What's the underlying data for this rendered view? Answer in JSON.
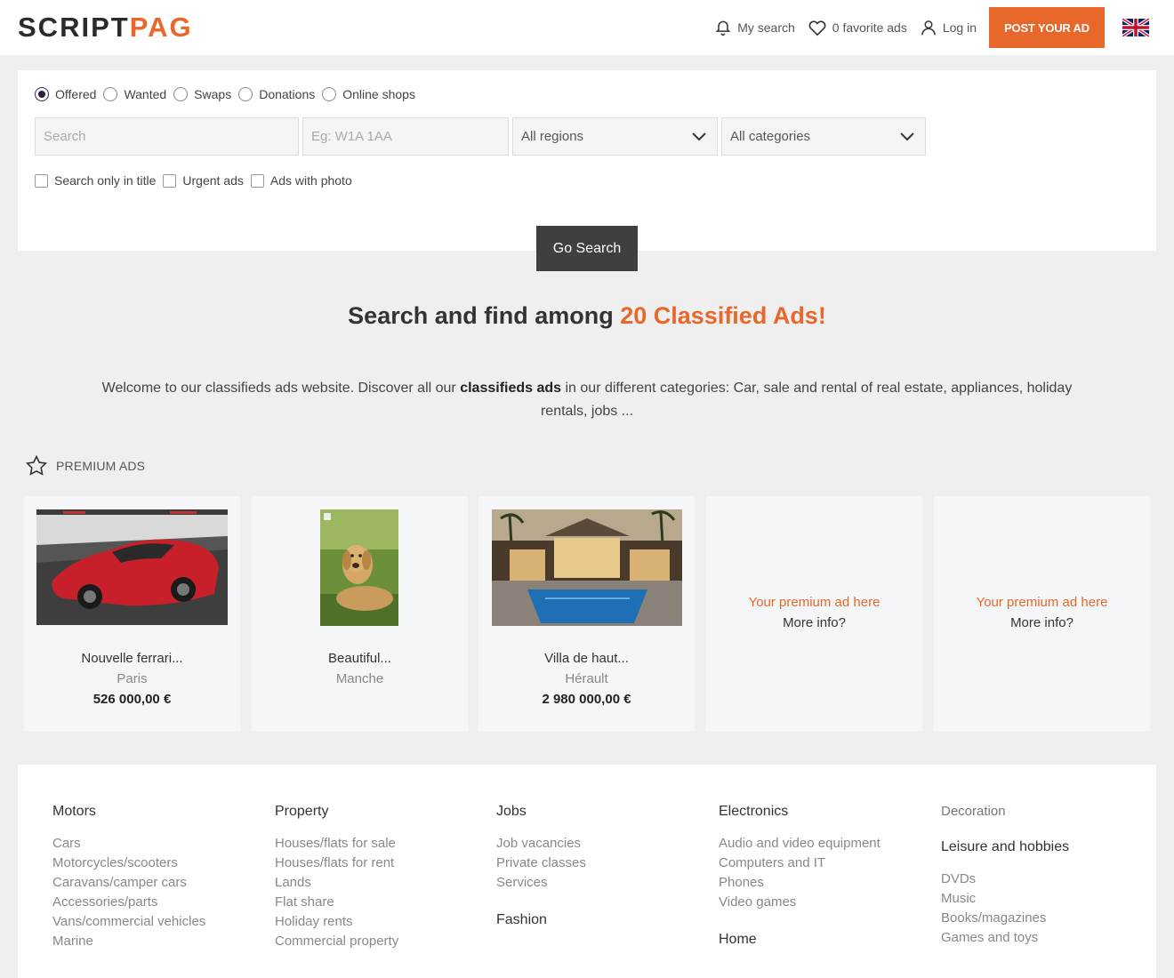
{
  "header": {
    "logo_part1": "SCRIPT",
    "logo_part2": "PAG",
    "my_search": "My search",
    "favorites": "0 favorite ads",
    "login": "Log in",
    "post_ad": "POST YOUR AD"
  },
  "search": {
    "types": [
      "Offered",
      "Wanted",
      "Swaps",
      "Donations",
      "Online shops"
    ],
    "selected_type": "Offered",
    "keyword_placeholder": "Search",
    "postcode_placeholder": "Eg: W1A 1AA",
    "region_selected": "All regions",
    "category_selected": "All categories",
    "filters": [
      "Search only in title",
      "Urgent ads",
      "Ads with photo"
    ],
    "submit": "Go Search"
  },
  "headline": {
    "prefix": "Search and find among",
    "highlight": "20 Classified Ads!"
  },
  "intro": {
    "part1": "Welcome to our classifieds ads website. Discover all our",
    "bold": "classifieds ads",
    "part2": "in our different categories: Car, sale and rental of real estate, appliances, holiday rentals, jobs ..."
  },
  "premium": {
    "title": "PREMIUM ADS",
    "ads": [
      {
        "title": "Nouvelle ferrari...",
        "location": "Paris",
        "price": "526 000,00 €"
      },
      {
        "title": "Beautiful...",
        "location": "Manche",
        "price": ""
      },
      {
        "title": "Villa de haut...",
        "location": "Hérault",
        "price": "2 980 000,00 €"
      }
    ],
    "placeholder_title": "Your premium ad here",
    "placeholder_link": "More info?"
  },
  "categories": {
    "motors": {
      "title": "Motors",
      "items": [
        "Cars",
        "Motorcycles/scooters",
        "Caravans/camper cars",
        "Accessories/parts",
        "Vans/commercial vehicles",
        "Marine"
      ]
    },
    "property": {
      "title": "Property",
      "items": [
        "Houses/flats for sale",
        "Houses/flats for rent",
        "Lands",
        "Flat share",
        "Holiday rents",
        "Commercial property"
      ]
    },
    "jobs": {
      "title": "Jobs",
      "items": [
        "Job vacancies",
        "Private classes",
        "Services"
      ]
    },
    "fashion": {
      "title": "Fashion"
    },
    "electronics": {
      "title": "Electronics",
      "items": [
        "Audio and video equipment",
        "Computers and IT",
        "Phones",
        "Video games"
      ]
    },
    "home": {
      "title": "Home"
    },
    "decoration": {
      "title": "Decoration"
    },
    "leisure": {
      "title": "Leisure and hobbies",
      "items": [
        "DVDs",
        "Music",
        "Books/magazines",
        "Games and toys"
      ]
    }
  },
  "colors": {
    "accent": "#e8672b",
    "dark_button": "#3f3f3f"
  }
}
